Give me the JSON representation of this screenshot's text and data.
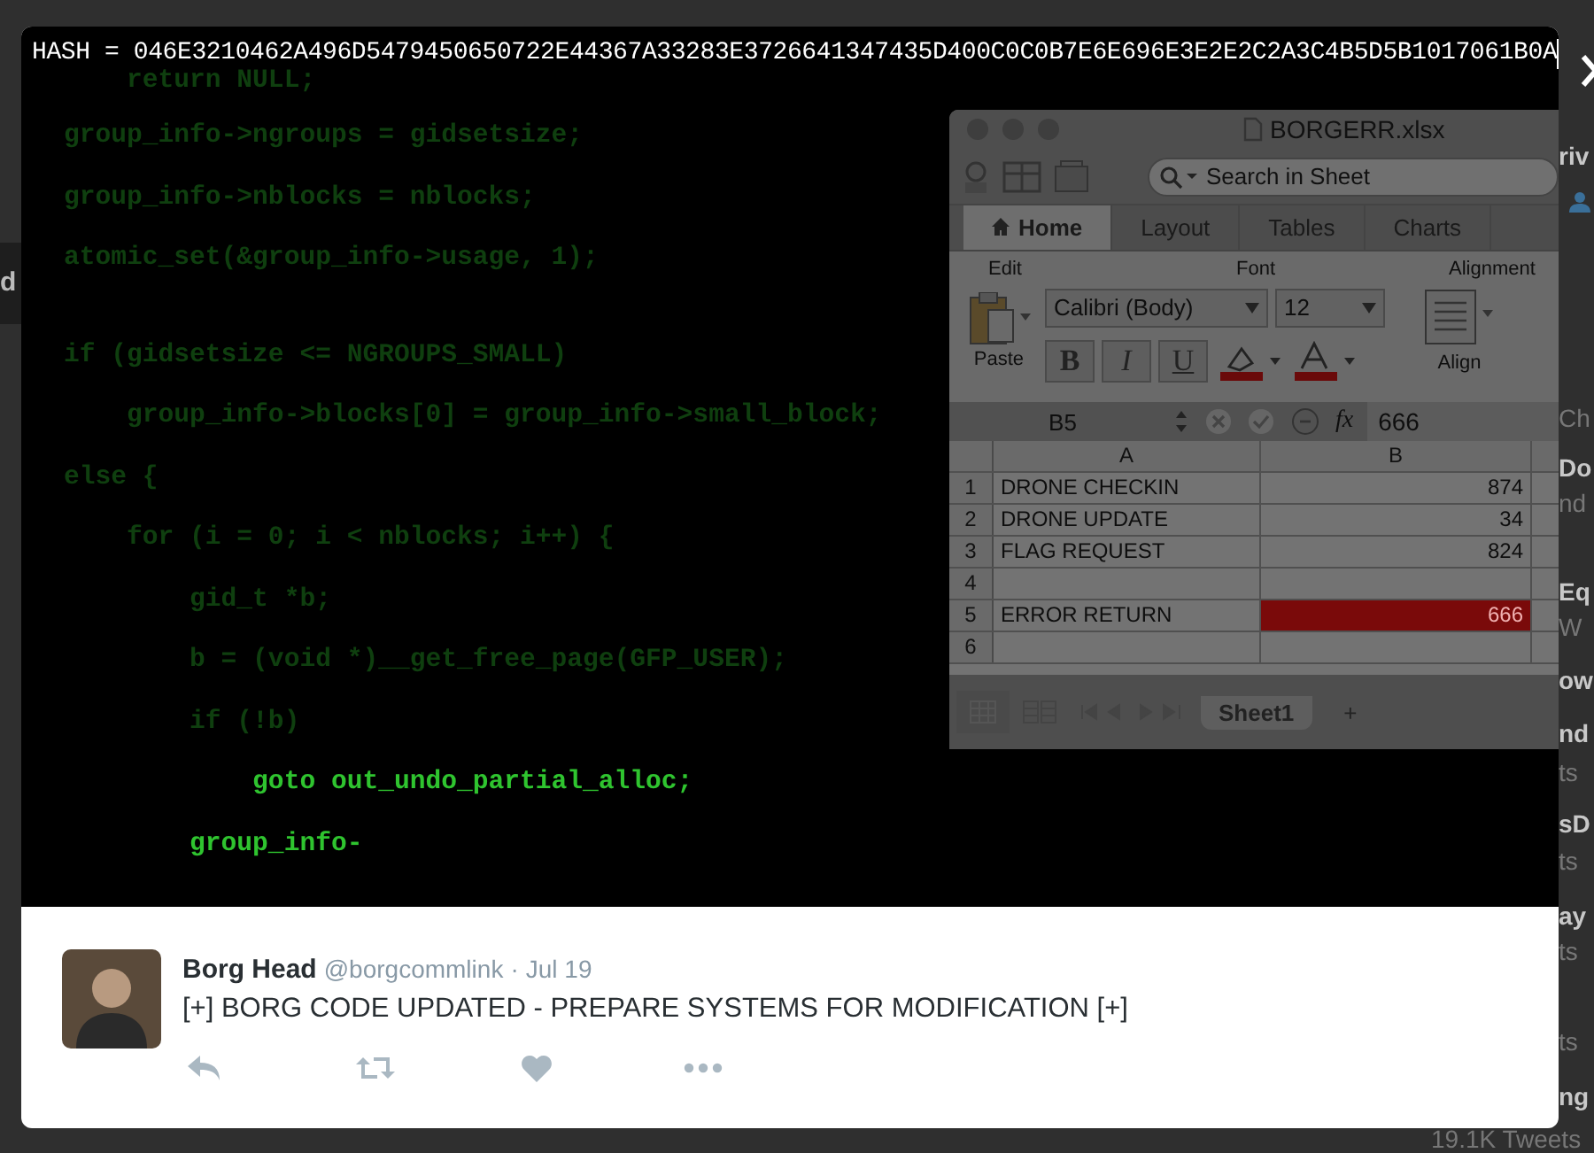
{
  "background_page": {
    "left_fragment": "d",
    "fragments": [
      {
        "text": "riv",
        "kind": "bold"
      },
      {
        "text": "Ch",
        "kind": "muted"
      },
      {
        "text": "Do",
        "kind": "bold"
      },
      {
        "text": "nd",
        "kind": "muted"
      },
      {
        "text": "Eq",
        "kind": "bold"
      },
      {
        "text": "W",
        "kind": "muted"
      },
      {
        "text": "ow",
        "kind": "bold"
      },
      {
        "text": "nd",
        "kind": "bold"
      },
      {
        "text": "ts",
        "kind": "muted"
      },
      {
        "text": "sD",
        "kind": "bold"
      },
      {
        "text": "ts",
        "kind": "muted"
      },
      {
        "text": "ay",
        "kind": "bold"
      },
      {
        "text": "ts",
        "kind": "muted"
      },
      {
        "text": "ts",
        "kind": "muted"
      },
      {
        "text": "ng",
        "kind": "bold"
      }
    ],
    "tweet_count": "19.1K Tweets"
  },
  "image": {
    "hash_line": "HASH = 046E3210462A496D5479450650722E44367A33283E3726641347435D400C0C0B7E6E696E3E2E2C2A3C4B5D5B1017061B0A",
    "code_lines": [
      {
        "text": "    return NULL;",
        "bright": false
      },
      {
        "text": "group_info->ngroups = gidsetsize;",
        "bright": false
      },
      {
        "text": "group_info->nblocks = nblocks;",
        "bright": false
      },
      {
        "text": "atomic_set(&group_info->usage, 1);",
        "bright": false
      },
      {
        "text": "if (gidsetsize <= NGROUPS_SMALL)",
        "bright": false
      },
      {
        "text": "    group_info->blocks[0] = group_info->small_block;",
        "bright": false
      },
      {
        "text": "else {",
        "bright": false
      },
      {
        "text": "    for (i = 0; i < nblocks; i++) {",
        "bright": false
      },
      {
        "text": "        gid_t *b;",
        "bright": false
      },
      {
        "text": "        b = (void *)__get_free_page(GFP_USER);",
        "bright": false
      },
      {
        "text": "        if (!b)",
        "bright": false
      },
      {
        "text": "            goto out_undo_partial_alloc;",
        "bright": true
      },
      {
        "text": "        group_info-",
        "bright": true
      }
    ],
    "spreadsheet": {
      "title": "BORGERR.xlsx",
      "search_placeholder": "Search in Sheet",
      "tabs": [
        {
          "label": "Home",
          "selected": true
        },
        {
          "label": "Layout",
          "selected": false
        },
        {
          "label": "Tables",
          "selected": false
        },
        {
          "label": "Charts",
          "selected": false
        }
      ],
      "groups": [
        "Edit",
        "Font",
        "Alignment"
      ],
      "paste_label": "Paste",
      "font_name": "Calibri (Body)",
      "font_size": "12",
      "bold": "B",
      "italic": "I",
      "underline": "U",
      "align_label": "Align",
      "cell_ref": "B5",
      "fx": "fx",
      "formula": "666",
      "columns": [
        "A",
        "B"
      ],
      "rows": [
        {
          "number": "1",
          "a": "DRONE CHECKIN",
          "b": "874",
          "selected": false
        },
        {
          "number": "2",
          "a": "DRONE UPDATE",
          "b": "34",
          "selected": false
        },
        {
          "number": "3",
          "a": "FLAG REQUEST",
          "b": "824",
          "selected": false
        },
        {
          "number": "4",
          "selected": false
        },
        {
          "number": "5",
          "a": "ERROR RETURN",
          "b": "666",
          "selected": true
        },
        {
          "number": "6",
          "selected": false
        }
      ],
      "sheet_tabs": [
        {
          "label": "Sheet1",
          "selected": true
        },
        {
          "label": "+",
          "selected": false
        }
      ]
    }
  },
  "tweet": {
    "name": "Borg Head",
    "handle": "@borgcommlink",
    "separator": "·",
    "date": "Jul 19",
    "text": "[+] BORG CODE UPDATED - PREPARE SYSTEMS FOR MODIFICATION [+]"
  }
}
